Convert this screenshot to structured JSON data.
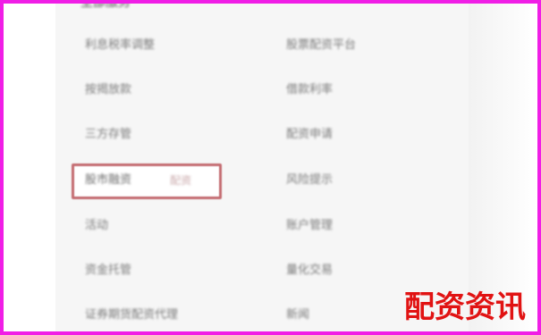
{
  "menu": {
    "heading": "全部服务",
    "left_items": [
      "利息税率调整",
      "按揭放款",
      "三方存管",
      "",
      "活动",
      "资金托管",
      "证券期货配资代理"
    ],
    "right_items": [
      "股票配资平台",
      "借款利率",
      "配资申请",
      "风险提示",
      "账户管理",
      "量化交易",
      "新闻"
    ]
  },
  "selected": {
    "label": "股市融资",
    "tip": "配资"
  },
  "watermark": "配资资讯",
  "colors": {
    "frame_border": "#f01ee6",
    "selection_border": "#c46c71",
    "watermark": "#e11313"
  }
}
